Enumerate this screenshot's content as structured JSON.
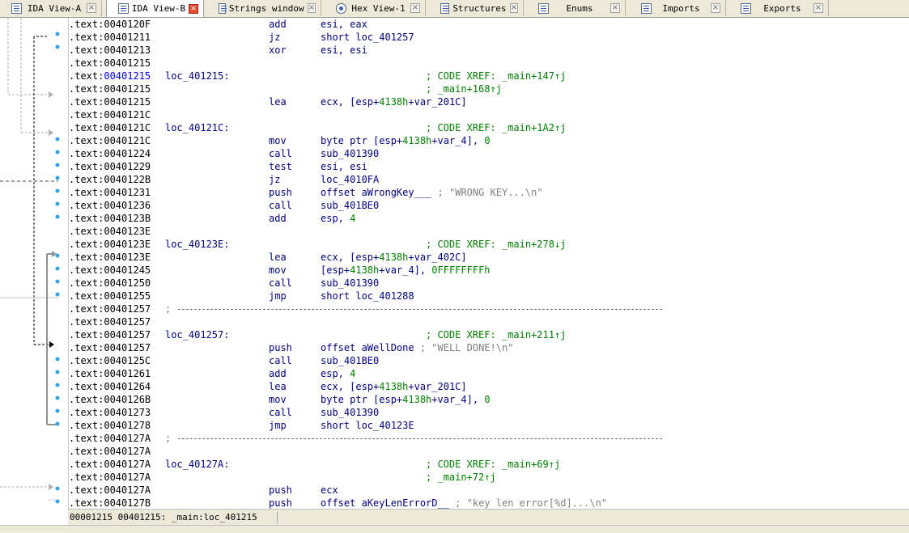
{
  "tabs": [
    {
      "label": "IDA View-A",
      "icon": "listing-icon",
      "active": false
    },
    {
      "label": "IDA View-B",
      "icon": "listing-icon",
      "active": true
    },
    {
      "label": "Strings window",
      "icon": "strings-icon",
      "active": false
    },
    {
      "label": "Hex View-1",
      "icon": "hex-icon",
      "active": false
    },
    {
      "label": "Structures",
      "icon": "structures-icon",
      "active": false
    },
    {
      "label": "Enums",
      "icon": "enums-icon",
      "active": false
    },
    {
      "label": "Imports",
      "icon": "imports-icon",
      "active": false
    },
    {
      "label": "Exports",
      "icon": "exports-icon",
      "active": false
    }
  ],
  "colors": {
    "address": "#000000",
    "selected_address": "#0000ff",
    "code": "#000080",
    "number": "#008000",
    "comment": "#808080",
    "xref": "#008000",
    "active_tab_close": "#e04a2a"
  },
  "listing": [
    {
      "addr": ".text:0040120F",
      "label": "",
      "mnem": "add",
      "ops": [
        [
          "esi, eax",
          "t"
        ]
      ],
      "xref": ""
    },
    {
      "addr": ".text:00401211",
      "label": "",
      "mnem": "jz",
      "ops": [
        [
          "short loc_401257",
          "t"
        ]
      ],
      "xref": ""
    },
    {
      "addr": ".text:00401213",
      "label": "",
      "mnem": "xor",
      "ops": [
        [
          "esi, esi",
          "t"
        ]
      ],
      "xref": ""
    },
    {
      "addr": ".text:00401215",
      "label": "",
      "mnem": "",
      "ops": [],
      "xref": ""
    },
    {
      "addr": ".text:00401215",
      "label": "loc_401215:",
      "mnem": "",
      "ops": [],
      "xref": "; CODE XREF: _main+147↑j",
      "selected": true
    },
    {
      "addr": ".text:00401215",
      "label": "",
      "mnem": "",
      "ops": [],
      "xref": "; _main+168↑j"
    },
    {
      "addr": ".text:00401215",
      "label": "",
      "mnem": "lea",
      "ops": [
        [
          "ecx, [esp+",
          "t"
        ],
        [
          "4138h",
          "n"
        ],
        [
          "+var_201C]",
          "t"
        ]
      ],
      "xref": ""
    },
    {
      "addr": ".text:0040121C",
      "label": "",
      "mnem": "",
      "ops": [],
      "xref": ""
    },
    {
      "addr": ".text:0040121C",
      "label": "loc_40121C:",
      "mnem": "",
      "ops": [],
      "xref": "; CODE XREF: _main+1A2↑j"
    },
    {
      "addr": ".text:0040121C",
      "label": "",
      "mnem": "mov",
      "ops": [
        [
          "byte ptr [esp+",
          "t"
        ],
        [
          "4138h",
          "n"
        ],
        [
          "+var_4], ",
          "t"
        ],
        [
          "0",
          "n"
        ]
      ],
      "xref": ""
    },
    {
      "addr": ".text:00401224",
      "label": "",
      "mnem": "call",
      "ops": [
        [
          "sub_401390",
          "t"
        ]
      ],
      "xref": ""
    },
    {
      "addr": ".text:00401229",
      "label": "",
      "mnem": "test",
      "ops": [
        [
          "esi, esi",
          "t"
        ]
      ],
      "xref": ""
    },
    {
      "addr": ".text:0040122B",
      "label": "",
      "mnem": "jz",
      "ops": [
        [
          "loc_4010FA",
          "t"
        ]
      ],
      "xref": ""
    },
    {
      "addr": ".text:00401231",
      "label": "",
      "mnem": "push",
      "ops": [
        [
          "offset aWrongKey___ ",
          "t"
        ],
        [
          "; \"WRONG KEY...\\n\"",
          "c"
        ]
      ],
      "xref": ""
    },
    {
      "addr": ".text:00401236",
      "label": "",
      "mnem": "call",
      "ops": [
        [
          "sub_401BE0",
          "t"
        ]
      ],
      "xref": ""
    },
    {
      "addr": ".text:0040123B",
      "label": "",
      "mnem": "add",
      "ops": [
        [
          "esp, ",
          "t"
        ],
        [
          "4",
          "n"
        ]
      ],
      "xref": ""
    },
    {
      "addr": ".text:0040123E",
      "label": "",
      "mnem": "",
      "ops": [],
      "xref": ""
    },
    {
      "addr": ".text:0040123E",
      "label": "loc_40123E:",
      "mnem": "",
      "ops": [],
      "xref": "; CODE XREF: _main+278↓j"
    },
    {
      "addr": ".text:0040123E",
      "label": "",
      "mnem": "lea",
      "ops": [
        [
          "ecx, [esp+",
          "t"
        ],
        [
          "4138h",
          "n"
        ],
        [
          "+var_402C]",
          "t"
        ]
      ],
      "xref": ""
    },
    {
      "addr": ".text:00401245",
      "label": "",
      "mnem": "mov",
      "ops": [
        [
          "[esp+",
          "t"
        ],
        [
          "4138h",
          "n"
        ],
        [
          "+var_4], ",
          "t"
        ],
        [
          "0FFFFFFFFh",
          "n"
        ]
      ],
      "xref": ""
    },
    {
      "addr": ".text:00401250",
      "label": "",
      "mnem": "call",
      "ops": [
        [
          "sub_401390",
          "t"
        ]
      ],
      "xref": ""
    },
    {
      "addr": ".text:00401255",
      "label": "",
      "mnem": "jmp",
      "ops": [
        [
          "short loc_401288",
          "t"
        ]
      ],
      "xref": ""
    },
    {
      "addr": ".text:00401257",
      "label": "",
      "mnem": "",
      "ops": [],
      "xref": "",
      "separator": ";"
    },
    {
      "addr": ".text:00401257",
      "label": "",
      "mnem": "",
      "ops": [],
      "xref": ""
    },
    {
      "addr": ".text:00401257",
      "label": "loc_401257:",
      "mnem": "",
      "ops": [],
      "xref": "; CODE XREF: _main+211↑j"
    },
    {
      "addr": ".text:00401257",
      "label": "",
      "mnem": "push",
      "ops": [
        [
          "offset aWellDone ",
          "t"
        ],
        [
          "; \"WELL DONE!\\n\"",
          "c"
        ]
      ],
      "xref": ""
    },
    {
      "addr": ".text:0040125C",
      "label": "",
      "mnem": "call",
      "ops": [
        [
          "sub_401BE0",
          "t"
        ]
      ],
      "xref": ""
    },
    {
      "addr": ".text:00401261",
      "label": "",
      "mnem": "add",
      "ops": [
        [
          "esp, ",
          "t"
        ],
        [
          "4",
          "n"
        ]
      ],
      "xref": ""
    },
    {
      "addr": ".text:00401264",
      "label": "",
      "mnem": "lea",
      "ops": [
        [
          "ecx, [esp+",
          "t"
        ],
        [
          "4138h",
          "n"
        ],
        [
          "+var_201C]",
          "t"
        ]
      ],
      "xref": ""
    },
    {
      "addr": ".text:0040126B",
      "label": "",
      "mnem": "mov",
      "ops": [
        [
          "byte ptr [esp+",
          "t"
        ],
        [
          "4138h",
          "n"
        ],
        [
          "+var_4], ",
          "t"
        ],
        [
          "0",
          "n"
        ]
      ],
      "xref": ""
    },
    {
      "addr": ".text:00401273",
      "label": "",
      "mnem": "call",
      "ops": [
        [
          "sub_401390",
          "t"
        ]
      ],
      "xref": ""
    },
    {
      "addr": ".text:00401278",
      "label": "",
      "mnem": "jmp",
      "ops": [
        [
          "short loc_40123E",
          "t"
        ]
      ],
      "xref": ""
    },
    {
      "addr": ".text:0040127A",
      "label": "",
      "mnem": "",
      "ops": [],
      "xref": "",
      "separator": ";"
    },
    {
      "addr": ".text:0040127A",
      "label": "",
      "mnem": "",
      "ops": [],
      "xref": ""
    },
    {
      "addr": ".text:0040127A",
      "label": "loc_40127A:",
      "mnem": "",
      "ops": [],
      "xref": "; CODE XREF: _main+69↑j"
    },
    {
      "addr": ".text:0040127A",
      "label": "",
      "mnem": "",
      "ops": [],
      "xref": "; _main+72↑j"
    },
    {
      "addr": ".text:0040127A",
      "label": "",
      "mnem": "push",
      "ops": [
        [
          "ecx",
          "t"
        ]
      ],
      "xref": ""
    },
    {
      "addr": ".text:0040127B",
      "label": "",
      "mnem": "push",
      "ops": [
        [
          "offset aKeyLenErrorD__ ",
          "t"
        ],
        [
          "; \"key len error[%d]...\\n\"",
          "c"
        ]
      ],
      "xref": ""
    }
  ],
  "status": {
    "location": "00001215 00401215: _main:loc_401215"
  }
}
